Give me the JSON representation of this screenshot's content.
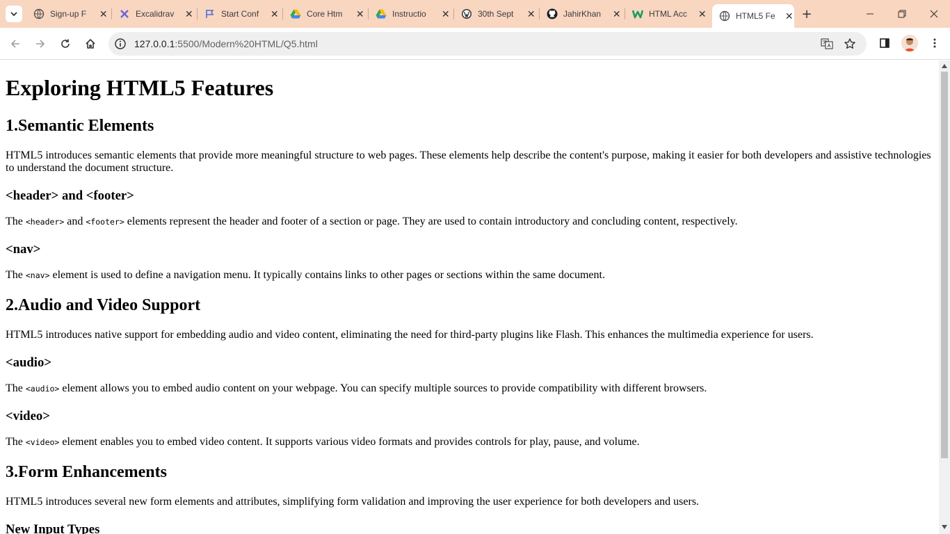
{
  "browser": {
    "tabs": [
      {
        "title": "Sign-up F",
        "icon": "globe-icon"
      },
      {
        "title": "Excalidrav",
        "icon": "excalidraw-icon"
      },
      {
        "title": "Start Conf",
        "icon": "flag-icon"
      },
      {
        "title": "Core Htm",
        "icon": "google-drive-icon"
      },
      {
        "title": "Instructio",
        "icon": "google-drive-icon"
      },
      {
        "title": "30th Sept",
        "icon": "wordpress-icon"
      },
      {
        "title": "JahirKhan",
        "icon": "github-icon"
      },
      {
        "title": "HTML Acc",
        "icon": "w-brand-icon"
      },
      {
        "title": "HTML5 Fe",
        "icon": "globe-icon",
        "active": true
      }
    ],
    "address": {
      "host": "127.0.0.1",
      "path": ":5500/Modern%20HTML/Q5.html"
    },
    "colors": {
      "tabstrip": "#f8d6c0",
      "accent_w": "#1a9e5b"
    }
  },
  "page": {
    "title": "Exploring HTML5 Features",
    "sections": [
      {
        "heading": "1.Semantic Elements",
        "intro": "HTML5 introduces semantic elements that provide more meaningful structure to web pages. These elements help describe the content's purpose, making it easier for both developers and assistive technologies to understand the document structure.",
        "items": [
          {
            "heading": "<header> and <footer>",
            "pre": "The ",
            "code1": "<header>",
            "mid": " and ",
            "code2": "<footer>",
            "post": " elements represent the header and footer of a section or page. They are used to contain introductory and concluding content, respectively."
          },
          {
            "heading": "<nav>",
            "pre": "The ",
            "code1": "<nav>",
            "post": " element is used to define a navigation menu. It typically contains links to other pages or sections within the same document."
          }
        ]
      },
      {
        "heading": "2.Audio and Video Support",
        "intro": "HTML5 introduces native support for embedding audio and video content, eliminating the need for third-party plugins like Flash. This enhances the multimedia experience for users.",
        "items": [
          {
            "heading": "<audio>",
            "pre": "The ",
            "code1": "<audio>",
            "post": " element allows you to embed audio content on your webpage. You can specify multiple sources to provide compatibility with different browsers."
          },
          {
            "heading": "<video>",
            "pre": "The ",
            "code1": "<video>",
            "post": " element enables you to embed video content. It supports various video formats and provides controls for play, pause, and volume."
          }
        ]
      },
      {
        "heading": "3.Form Enhancements",
        "intro": "HTML5 introduces several new form elements and attributes, simplifying form validation and improving the user experience for both developers and users.",
        "items": [
          {
            "heading": "New Input Types"
          }
        ]
      }
    ]
  }
}
